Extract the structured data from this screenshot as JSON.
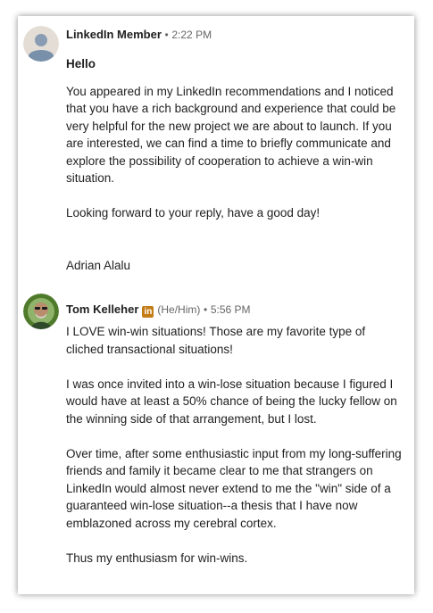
{
  "messages": [
    {
      "sender": "LinkedIn Member",
      "time": "2:22 PM",
      "greeting": "Hello",
      "paragraphs": [
        "You appeared in my LinkedIn recommendations and I noticed that you have a rich background and experience that could be very helpful for the new project we are about to launch. If you are interested, we can find a time to briefly communicate and explore the possibility of cooperation to achieve a win-win situation.",
        "Looking forward to your reply, have a good day!",
        "Adrian Alalu"
      ]
    },
    {
      "sender": "Tom Kelleher",
      "badge": "in",
      "pronouns": "(He/Him)",
      "time": "5:56 PM",
      "paragraphs": [
        "I LOVE win-win situations! Those are my favorite type of cliched transactional situations!",
        "I was once invited into a win-lose situation because I figured I would have at least a 50% chance of being the lucky fellow on the winning side of that arrangement, but I lost.",
        "Over time, after some enthusiastic input from my long-suffering friends and family it became clear to me that strangers on LinkedIn would almost never extend to me the \"win\" side of a guaranteed win-lose situation--a thesis that I have now emblazoned across my cerebral cortex.",
        "Thus my enthusiasm for win-wins."
      ]
    }
  ],
  "separator": "•",
  "colors": {
    "badge": "#c37d16",
    "muted": "#666666",
    "text": "#1f1f1f"
  },
  "icons": {
    "avatar1": "generic-person-avatar",
    "avatar2": "profile-photo-avatar"
  }
}
